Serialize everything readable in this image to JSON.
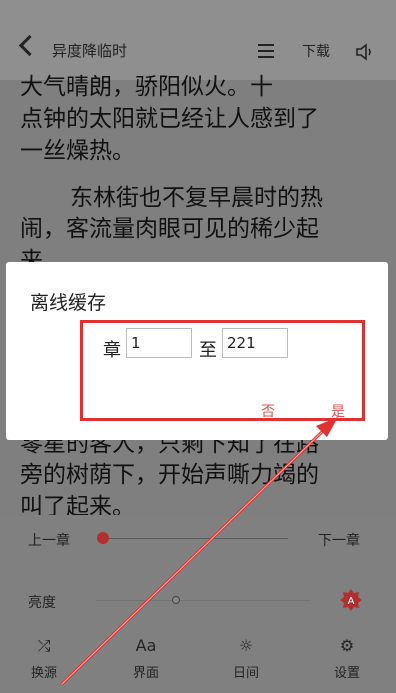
{
  "topbar": {
    "title": "异度降临时",
    "download_label": "下载"
  },
  "content": {
    "lines": [
      "大气晴朗，骄阳似火。十",
      "点钟的太阳就已经让人感到了",
      "一丝燥热。",
      "东林街也不复早晨时的热",
      "闹，客流量肉眼可见的稀少起",
      "来。",
      "零星的客人，只剩下知了在路",
      "旁的树荫下，开始声嘶力竭的",
      "叫了起来。"
    ]
  },
  "dialog": {
    "title": "离线缓存",
    "chapter_label": "章",
    "start_chapter": "1",
    "to_label": "至",
    "end_chapter": "221",
    "no_label": "否",
    "yes_label": "是"
  },
  "controls": {
    "prev_chapter": "上一章",
    "next_chapter": "下一章",
    "brightness_label": "亮度",
    "chapter_progress": 0.02,
    "brightness_level": 0.35
  },
  "tabs": [
    {
      "label": "换源",
      "icon": "shuffle-icon"
    },
    {
      "label": "界面",
      "icon": "font-size-icon"
    },
    {
      "label": "日间",
      "icon": "sun-icon"
    },
    {
      "label": "设置",
      "icon": "gear-icon"
    }
  ],
  "colors": {
    "accent": "#b03030",
    "highlight_box": "#e03030",
    "dialog_button": "#e05050"
  }
}
